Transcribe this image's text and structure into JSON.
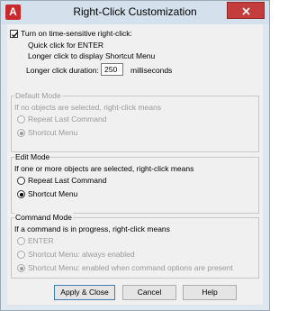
{
  "window": {
    "title": "Right-Click Customization",
    "app_icon_letter": "A"
  },
  "colors": {
    "title_bar": "#d4e0ec",
    "close_button": "#c43c3c"
  },
  "time_sensitive": {
    "checkbox_label": "Turn on time-sensitive right-click:",
    "checked": true,
    "quick_click_text": "Quick click for ENTER",
    "longer_click_text": "Longer click to display Shortcut Menu",
    "duration_label": "Longer click duration:",
    "duration_value": "250",
    "duration_unit": "milliseconds"
  },
  "default_mode": {
    "title": "Default Mode",
    "description": "If no objects are selected, right-click means",
    "options": [
      "Repeat Last Command",
      "Shortcut Menu"
    ],
    "selected": "Shortcut Menu",
    "enabled": false
  },
  "edit_mode": {
    "title": "Edit Mode",
    "description": "If one or more objects are selected, right-click means",
    "options": [
      "Repeat Last Command",
      "Shortcut Menu"
    ],
    "selected": "Shortcut Menu",
    "enabled": true
  },
  "command_mode": {
    "title": "Command Mode",
    "description": "If a command is in progress, right-click means",
    "options": [
      "ENTER",
      "Shortcut Menu: always enabled",
      "Shortcut Menu: enabled when command options are present"
    ],
    "selected": "Shortcut Menu: enabled when command options are present",
    "enabled": false
  },
  "buttons": {
    "apply": "Apply & Close",
    "cancel": "Cancel",
    "help": "Help"
  }
}
